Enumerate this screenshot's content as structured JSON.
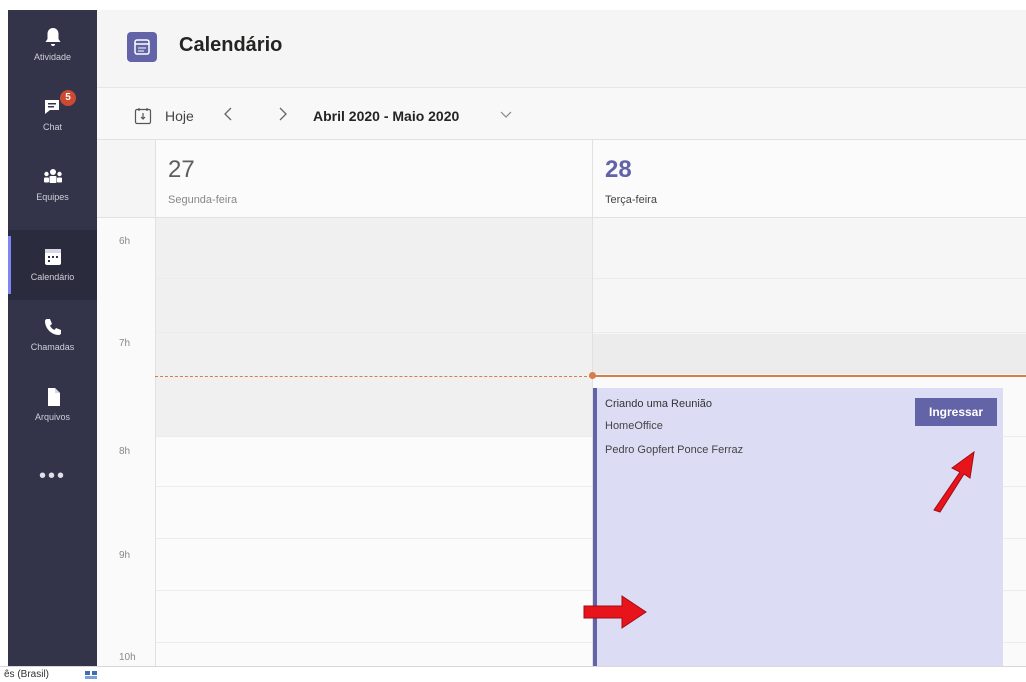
{
  "rail": {
    "items": [
      {
        "label": "Atividade",
        "icon": "bell-icon"
      },
      {
        "label": "Chat",
        "icon": "chat-icon",
        "badge": "5"
      },
      {
        "label": "Equipes",
        "icon": "teams-icon"
      },
      {
        "label": "Calendário",
        "icon": "calendar-icon",
        "active": true
      },
      {
        "label": "Chamadas",
        "icon": "phone-icon"
      },
      {
        "label": "Arquivos",
        "icon": "file-icon"
      }
    ],
    "more": "•••"
  },
  "header": {
    "title": "Calendário"
  },
  "toolbar": {
    "today_label": "Hoje",
    "range_label": "Abril 2020 - Maio 2020"
  },
  "days": [
    {
      "number": "27",
      "name": "Segunda-feira"
    },
    {
      "number": "28",
      "name": "Terça-feira"
    }
  ],
  "times": [
    "6h",
    "7h",
    "8h",
    "9h",
    "10h"
  ],
  "event": {
    "title": "Criando uma Reunião",
    "location": "HomeOffice",
    "organizer": "Pedro Gopfert Ponce Ferraz",
    "join_label": "Ingressar"
  },
  "statusbar": {
    "language": "ês (Brasil)"
  },
  "colors": {
    "rail": "#33344a",
    "accent": "#6264a7",
    "event_bg": "#dcdcf5",
    "now_line": "#d77d4b",
    "arrow": "#e8141b",
    "badge": "#cc4a31"
  }
}
